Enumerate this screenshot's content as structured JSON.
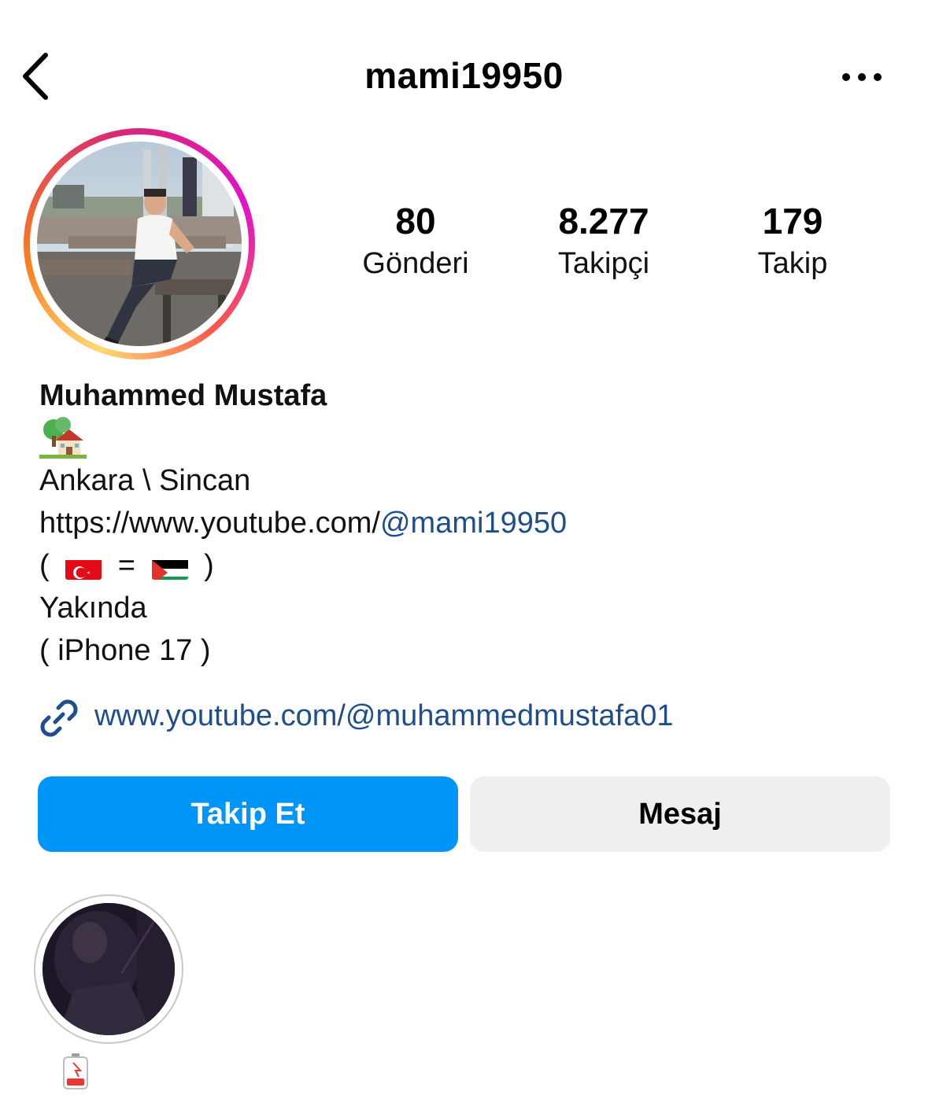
{
  "header": {
    "username": "mami19950",
    "back_icon": "chevron-left-icon",
    "more_icon": "more-horizontal-icon"
  },
  "stats": [
    {
      "value": "80",
      "label": "Gönderi"
    },
    {
      "value": "8.277",
      "label": "Takipçi"
    },
    {
      "value": "179",
      "label": "Takip"
    }
  ],
  "bio": {
    "name": "Muhammed Mustafa",
    "emoji": "house-with-garden-emoji",
    "location": "Ankara \\ Sincan",
    "youtube_prefix": "https://www.youtube.com/",
    "youtube_mention": "@mami19950",
    "flags_open": "(",
    "flags_equals": "=",
    "flags_close": ")",
    "soon": "Yakında",
    "phone": "( iPhone 17 )"
  },
  "link": {
    "icon": "link-icon",
    "text": "www.youtube.com/@muhammedmustafa01"
  },
  "buttons": {
    "follow": "Takip Et",
    "message": "Mesaj"
  },
  "highlights": [
    {
      "label_icon": "low-battery-emoji"
    }
  ],
  "colors": {
    "follow_button": "#0095f6",
    "message_button": "#efefef",
    "link_text": "#1f4e8c"
  }
}
